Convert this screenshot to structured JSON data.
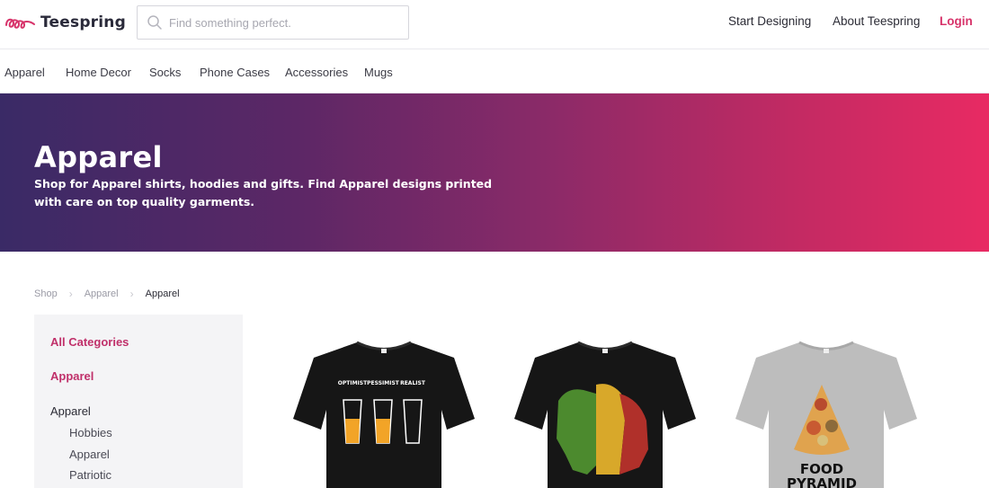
{
  "brand": {
    "name": "Teespring",
    "logo_color": "#d7336a"
  },
  "search": {
    "placeholder": "Find something perfect."
  },
  "top_nav": {
    "start_designing": "Start Designing",
    "about": "About Teespring",
    "login": "Login"
  },
  "categories": [
    "Apparel",
    "Home Decor",
    "Socks",
    "Phone Cases",
    "Accessories",
    "Mugs"
  ],
  "hero": {
    "title": "Apparel",
    "description": "Shop for Apparel shirts, hoodies and gifts. Find Apparel designs printed with care on top quality garments."
  },
  "breadcrumb": {
    "items": [
      "Shop",
      "Apparel",
      "Apparel"
    ]
  },
  "sidebar": {
    "all_categories": "All Categories",
    "parent": "Apparel",
    "current": "Apparel",
    "subcategories": [
      "Hobbies",
      "Apparel",
      "Patriotic"
    ]
  },
  "products": [
    {
      "shirt_color": "#161616",
      "print_text": [
        "OPTIMIST",
        "PESSIMIST",
        "REALIST"
      ]
    },
    {
      "shirt_color": "#161616"
    },
    {
      "shirt_color": "#bdbdbd",
      "print_text": [
        "FOOD",
        "PYRAMID"
      ]
    }
  ],
  "colors": {
    "accent": "#d7336a",
    "sidebar_bg": "#f4f4f6",
    "hero_start": "#3a2a66",
    "hero_end": "#e82a63"
  }
}
